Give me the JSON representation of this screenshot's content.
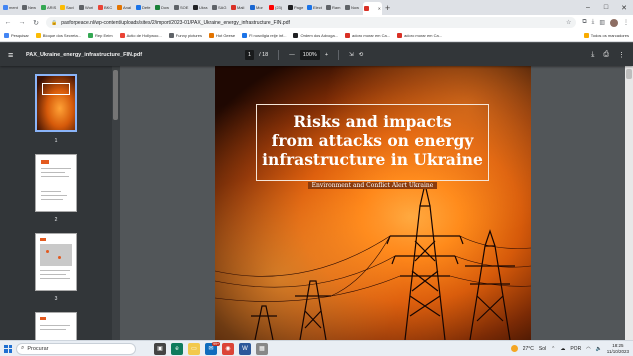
{
  "browser": {
    "tabs": [
      {
        "label": "ment",
        "color": "#4285f4"
      },
      {
        "label": "New",
        "color": "#5f6368"
      },
      {
        "label": "ARIS",
        "color": "#34a853"
      },
      {
        "label": "Savi",
        "color": "#fbbc04"
      },
      {
        "label": "Wori",
        "color": "#5f6368"
      },
      {
        "label": "BKC",
        "color": "#ea4335"
      },
      {
        "label": "Anal",
        "color": "#e37400"
      },
      {
        "label": "Defe",
        "color": "#1a73e8"
      },
      {
        "label": "Dow",
        "color": "#188038"
      },
      {
        "label": "SOE",
        "color": "#5f6368"
      },
      {
        "label": "Ukra",
        "color": "#202124"
      },
      {
        "label": "SAG",
        "color": "#5f6368"
      },
      {
        "label": "Mali",
        "color": "#d93025"
      },
      {
        "label": "Mor",
        "color": "#1967d2"
      },
      {
        "label": "(23)",
        "color": "#ff0000"
      },
      {
        "label": "Page",
        "color": "#202124"
      },
      {
        "label": "Elect",
        "color": "#1a73e8"
      },
      {
        "label": "Ram",
        "color": "#5f6368"
      },
      {
        "label": "Now",
        "color": "#5f6368"
      },
      {
        "label": "",
        "color": "#d93025",
        "active": true
      }
    ],
    "url": "paxforpeace.nl/wp-content/uploads/sites/2/import/2023-01/PAX_Ukraine_energy_infrastructure_FIN.pdf",
    "bookmarks": [
      {
        "label": "Pesquisar",
        "color": "#4285f4"
      },
      {
        "label": "Bloque dos Secreta...",
        "color": "#fbbc04"
      },
      {
        "label": "Rep Eeim",
        "color": "#34a853"
      },
      {
        "label": "Actio de Hollywoo...",
        "color": "#ea4335"
      },
      {
        "label": "Funny pictures",
        "color": "#5f6368"
      },
      {
        "label": "Hot Geese",
        "color": "#e37400"
      },
      {
        "label": "Fl nosvilgia reije inf...",
        "color": "#1a73e8"
      },
      {
        "label": "Ordem dos Advoga...",
        "color": "#202124"
      },
      {
        "label": "adoro morar em Ca...",
        "color": "#d93025"
      },
      {
        "label": "adoro morar em Ca...",
        "color": "#d93025"
      }
    ],
    "bookmarks_all": "Todos os marcadores"
  },
  "pdf": {
    "filename": "PAX_Ukraine_energy_infrastructure_FIN.pdf",
    "page_current": "1",
    "page_total": "/ 18",
    "zoom": "100%",
    "thumbnails": [
      "1",
      "2",
      "3"
    ],
    "cover": {
      "title": "Risks and impacts\nfrom attacks on energy\ninfrastructure in Ukraine",
      "subtitle": "Environment and Conflict Alert Ukraine"
    }
  },
  "taskbar": {
    "search_label": "Procurar",
    "badge": "99+",
    "temperature": "27°C",
    "weather": "Sol",
    "language": "POR",
    "time": "18:25",
    "date": "11/10/2023"
  }
}
